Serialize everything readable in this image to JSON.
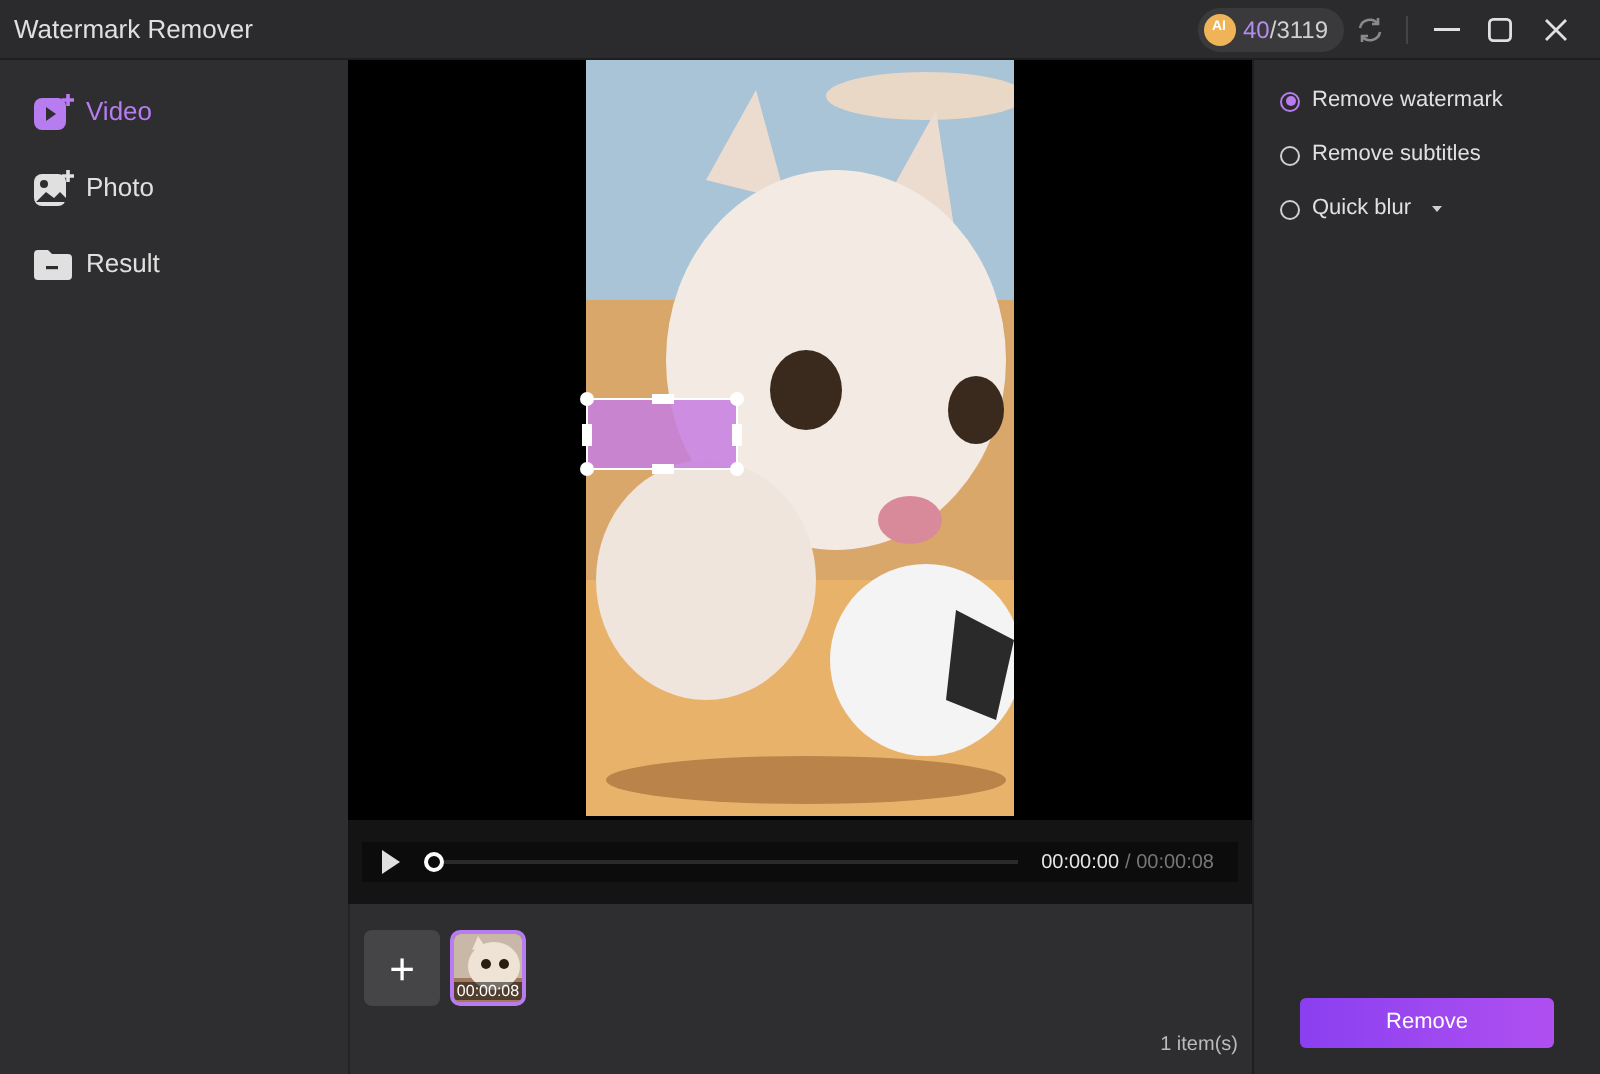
{
  "window": {
    "title": "Watermark Remover"
  },
  "credits": {
    "coin": "AI",
    "used": "40",
    "total": "/3119"
  },
  "sidebar": {
    "items": [
      {
        "label": "Video",
        "kind": "video",
        "selected": true
      },
      {
        "label": "Photo",
        "selected": false
      },
      {
        "label": "Result",
        "kind": "folder",
        "selected": false
      }
    ]
  },
  "player": {
    "level": 0,
    "current": "00:00:00",
    "duration": "/ 00:00:08",
    "selection": true
  },
  "tray": {
    "add": "+",
    "items": [
      {
        "kind": "picture",
        "duration": "00:00:08",
        "selected": true
      }
    ],
    "count": "1 item(s)"
  },
  "options": [
    {
      "label": "Remove watermark",
      "selected": true,
      "dropdown": false
    },
    {
      "label": "Remove subtitles",
      "selected": false,
      "dropdown": false
    },
    {
      "label": "Quick blur",
      "selected": false,
      "dropdown": true
    }
  ],
  "action": {
    "label": "Remove"
  }
}
